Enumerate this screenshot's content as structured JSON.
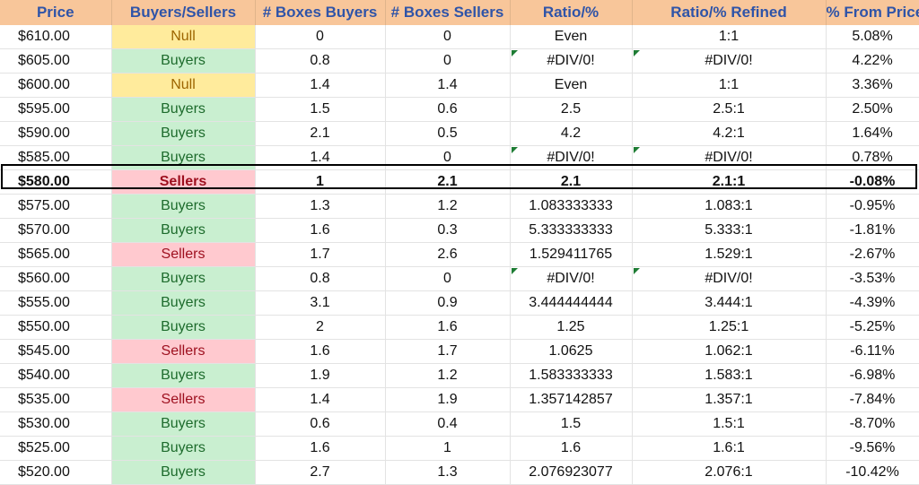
{
  "sheet": {
    "headers": [
      "Price",
      "Buyers/Sellers",
      "# Boxes Buyers",
      "# Boxes Sellers",
      "Ratio/%",
      "Ratio/% Refined",
      "% From Price"
    ],
    "current_price_row": 6,
    "error_indicator_color": "#1e7c34",
    "rows": [
      {
        "price": "$610.00",
        "side": "Null",
        "buyers": "0",
        "sellers": "0",
        "ratio": "Even",
        "refined": "1:1",
        "pct": "5.08%",
        "err": false
      },
      {
        "price": "$605.00",
        "side": "Buyers",
        "buyers": "0.8",
        "sellers": "0",
        "ratio": "#DIV/0!",
        "refined": "#DIV/0!",
        "pct": "4.22%",
        "err": true
      },
      {
        "price": "$600.00",
        "side": "Null",
        "buyers": "1.4",
        "sellers": "1.4",
        "ratio": "Even",
        "refined": "1:1",
        "pct": "3.36%",
        "err": false
      },
      {
        "price": "$595.00",
        "side": "Buyers",
        "buyers": "1.5",
        "sellers": "0.6",
        "ratio": "2.5",
        "refined": "2.5:1",
        "pct": "2.50%",
        "err": false
      },
      {
        "price": "$590.00",
        "side": "Buyers",
        "buyers": "2.1",
        "sellers": "0.5",
        "ratio": "4.2",
        "refined": "4.2:1",
        "pct": "1.64%",
        "err": false
      },
      {
        "price": "$585.00",
        "side": "Buyers",
        "buyers": "1.4",
        "sellers": "0",
        "ratio": "#DIV/0!",
        "refined": "#DIV/0!",
        "pct": "0.78%",
        "err": true
      },
      {
        "price": "$580.00",
        "side": "Sellers",
        "buyers": "1",
        "sellers": "2.1",
        "ratio": "2.1",
        "refined": "2.1:1",
        "pct": "-0.08%",
        "err": false
      },
      {
        "price": "$575.00",
        "side": "Buyers",
        "buyers": "1.3",
        "sellers": "1.2",
        "ratio": "1.083333333",
        "refined": "1.083:1",
        "pct": "-0.95%",
        "err": false
      },
      {
        "price": "$570.00",
        "side": "Buyers",
        "buyers": "1.6",
        "sellers": "0.3",
        "ratio": "5.333333333",
        "refined": "5.333:1",
        "pct": "-1.81%",
        "err": false
      },
      {
        "price": "$565.00",
        "side": "Sellers",
        "buyers": "1.7",
        "sellers": "2.6",
        "ratio": "1.529411765",
        "refined": "1.529:1",
        "pct": "-2.67%",
        "err": false
      },
      {
        "price": "$560.00",
        "side": "Buyers",
        "buyers": "0.8",
        "sellers": "0",
        "ratio": "#DIV/0!",
        "refined": "#DIV/0!",
        "pct": "-3.53%",
        "err": true
      },
      {
        "price": "$555.00",
        "side": "Buyers",
        "buyers": "3.1",
        "sellers": "0.9",
        "ratio": "3.444444444",
        "refined": "3.444:1",
        "pct": "-4.39%",
        "err": false
      },
      {
        "price": "$550.00",
        "side": "Buyers",
        "buyers": "2",
        "sellers": "1.6",
        "ratio": "1.25",
        "refined": "1.25:1",
        "pct": "-5.25%",
        "err": false
      },
      {
        "price": "$545.00",
        "side": "Sellers",
        "buyers": "1.6",
        "sellers": "1.7",
        "ratio": "1.0625",
        "refined": "1.062:1",
        "pct": "-6.11%",
        "err": false
      },
      {
        "price": "$540.00",
        "side": "Buyers",
        "buyers": "1.9",
        "sellers": "1.2",
        "ratio": "1.583333333",
        "refined": "1.583:1",
        "pct": "-6.98%",
        "err": false
      },
      {
        "price": "$535.00",
        "side": "Sellers",
        "buyers": "1.4",
        "sellers": "1.9",
        "ratio": "1.357142857",
        "refined": "1.357:1",
        "pct": "-7.84%",
        "err": false
      },
      {
        "price": "$530.00",
        "side": "Buyers",
        "buyers": "0.6",
        "sellers": "0.4",
        "ratio": "1.5",
        "refined": "1.5:1",
        "pct": "-8.70%",
        "err": false
      },
      {
        "price": "$525.00",
        "side": "Buyers",
        "buyers": "1.6",
        "sellers": "1",
        "ratio": "1.6",
        "refined": "1.6:1",
        "pct": "-9.56%",
        "err": false
      },
      {
        "price": "$520.00",
        "side": "Buyers",
        "buyers": "2.7",
        "sellers": "1.3",
        "ratio": "2.076923077",
        "refined": "2.076:1",
        "pct": "-10.42%",
        "err": false
      }
    ]
  }
}
